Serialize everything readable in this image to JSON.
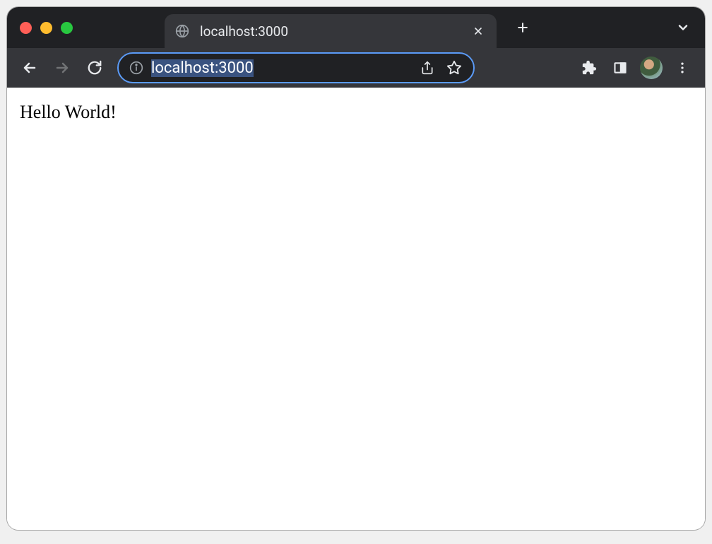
{
  "tab": {
    "title": "localhost:3000",
    "favicon": "globe-icon"
  },
  "address": {
    "url": "localhost:3000"
  },
  "page": {
    "body": "Hello World!"
  }
}
